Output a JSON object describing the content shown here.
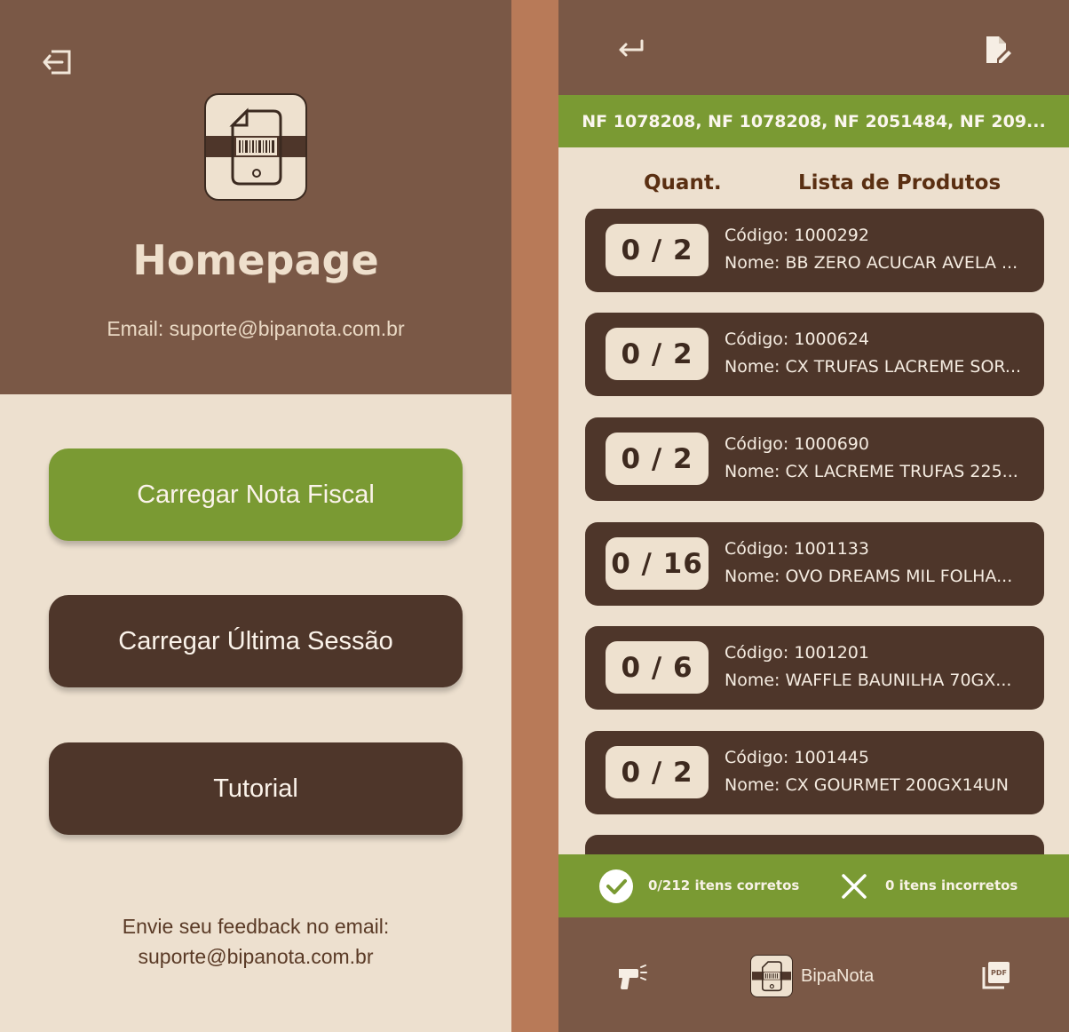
{
  "home": {
    "title": "Homepage",
    "email_line": "Email: suporte@bipanota.com.br",
    "buttons": {
      "load_invoice": "Carregar Nota Fiscal",
      "load_last_session": "Carregar Última Sessão",
      "tutorial": "Tutorial"
    },
    "feedback": {
      "line1": "Envie seu feedback no email:",
      "line2": "suporte@bipanota.com.br"
    },
    "icons": {
      "logout": "logout-icon",
      "logo": "barcode-document-logo"
    }
  },
  "products_screen": {
    "nf_list": "NF 1078208, NF 1078208, NF 2051484, NF 209...",
    "columns": {
      "quantity": "Quant.",
      "list": "Lista de Produtos"
    },
    "products": [
      {
        "qty": "0 / 2",
        "code": "Código: 1000292",
        "name": "Nome: BB ZERO ACUCAR AVELA ..."
      },
      {
        "qty": "0 / 2",
        "code": "Código: 1000624",
        "name": "Nome: CX TRUFAS LACREME SOR..."
      },
      {
        "qty": "0 / 2",
        "code": "Código: 1000690",
        "name": "Nome: CX LACREME TRUFAS 225..."
      },
      {
        "qty": "0 / 16",
        "code": "Código: 1001133",
        "name": "Nome: OVO DREAMS MIL FOLHA..."
      },
      {
        "qty": "0 / 6",
        "code": "Código: 1001201",
        "name": "Nome: WAFFLE BAUNILHA 70GX..."
      },
      {
        "qty": "0 / 2",
        "code": "Código: 1001445",
        "name": "Nome: CX GOURMET 200GX14UN"
      }
    ],
    "status": {
      "correct": "0/212 itens corretos",
      "incorrect": "0 itens incorretos"
    },
    "nav": {
      "brand": "BipaNota"
    },
    "icons": {
      "back": "back-arrow-icon",
      "edit": "edit-document-icon",
      "check": "check-circle-icon",
      "wrong": "close-icon",
      "scan": "barcode-scanner-icon",
      "pdf": "pdf-icon"
    }
  },
  "colors": {
    "brown_header": "#7a5846",
    "dark_brown": "#4e362a",
    "cream": "#ede0cf",
    "green": "#7a9a33",
    "divider": "#b87a58"
  }
}
